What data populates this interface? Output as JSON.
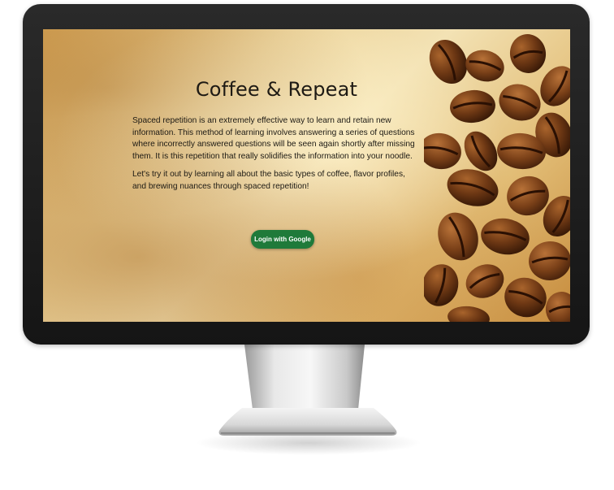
{
  "app": {
    "title": "Coffee & Repeat",
    "intro_paragraph": "Spaced repetition is an extremely effective way to learn and retain new information. This method of learning involves answering a series of questions where incorrectly answered questions will be seen again shortly after missing them. It is this repetition that really solidifies the information into your noodle.",
    "cta_paragraph": "Let's try it out by learning all about the basic types of coffee, flavor profiles, and brewing nuances through spaced repetition!",
    "login_button_label": "Login with Google"
  },
  "colors": {
    "button_green": "#1f7a3a",
    "bezel": "#1a1a1a",
    "title_text": "#1e1a14"
  },
  "icons": {
    "background_image": "coffee-beans-image"
  }
}
